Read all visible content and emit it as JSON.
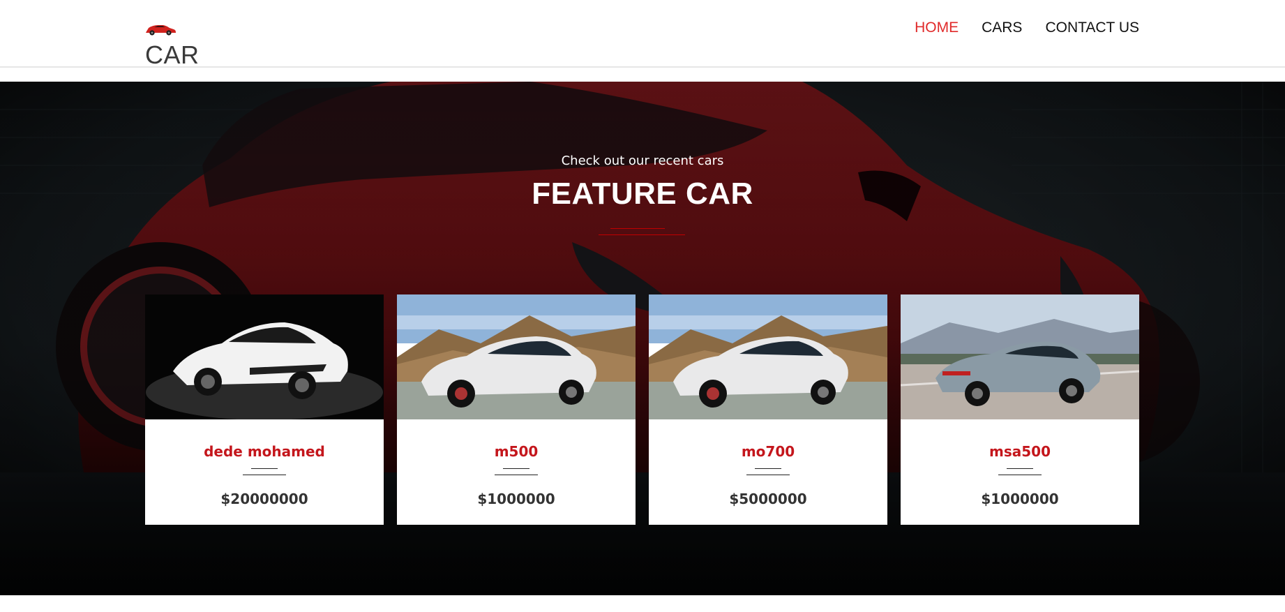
{
  "header": {
    "logo_icon": "red-sports-car-icon",
    "brand": "CAR",
    "nav": [
      {
        "label": "HOME",
        "active": true
      },
      {
        "label": "CARS",
        "active": false
      },
      {
        "label": "CONTACT US",
        "active": false
      }
    ]
  },
  "hero": {
    "subtitle": "Check out our recent cars",
    "title": "FEATURE CAR"
  },
  "cars": [
    {
      "name": "dede mohamed",
      "price": "$20000000"
    },
    {
      "name": "m500",
      "price": "$1000000"
    },
    {
      "name": "mo700",
      "price": "$5000000"
    },
    {
      "name": "msa500",
      "price": "$1000000"
    }
  ],
  "colors": {
    "accent": "#e02a2a",
    "card_name": "#c4161c",
    "hero_dark": "#0c0f12"
  }
}
